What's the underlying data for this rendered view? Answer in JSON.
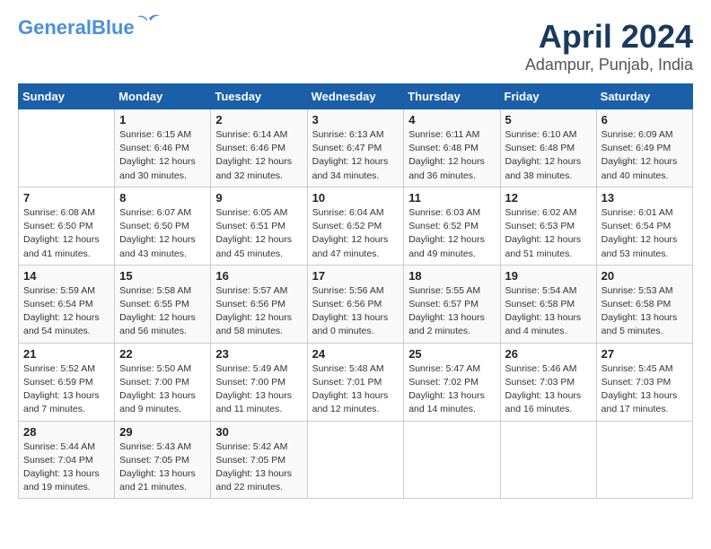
{
  "header": {
    "logo_line1": "General",
    "logo_line2": "Blue",
    "title": "April 2024",
    "subtitle": "Adampur, Punjab, India"
  },
  "days_of_week": [
    "Sunday",
    "Monday",
    "Tuesday",
    "Wednesday",
    "Thursday",
    "Friday",
    "Saturday"
  ],
  "weeks": [
    [
      {
        "day": "",
        "info": ""
      },
      {
        "day": "1",
        "info": "Sunrise: 6:15 AM\nSunset: 6:46 PM\nDaylight: 12 hours\nand 30 minutes."
      },
      {
        "day": "2",
        "info": "Sunrise: 6:14 AM\nSunset: 6:46 PM\nDaylight: 12 hours\nand 32 minutes."
      },
      {
        "day": "3",
        "info": "Sunrise: 6:13 AM\nSunset: 6:47 PM\nDaylight: 12 hours\nand 34 minutes."
      },
      {
        "day": "4",
        "info": "Sunrise: 6:11 AM\nSunset: 6:48 PM\nDaylight: 12 hours\nand 36 minutes."
      },
      {
        "day": "5",
        "info": "Sunrise: 6:10 AM\nSunset: 6:48 PM\nDaylight: 12 hours\nand 38 minutes."
      },
      {
        "day": "6",
        "info": "Sunrise: 6:09 AM\nSunset: 6:49 PM\nDaylight: 12 hours\nand 40 minutes."
      }
    ],
    [
      {
        "day": "7",
        "info": "Sunrise: 6:08 AM\nSunset: 6:50 PM\nDaylight: 12 hours\nand 41 minutes."
      },
      {
        "day": "8",
        "info": "Sunrise: 6:07 AM\nSunset: 6:50 PM\nDaylight: 12 hours\nand 43 minutes."
      },
      {
        "day": "9",
        "info": "Sunrise: 6:05 AM\nSunset: 6:51 PM\nDaylight: 12 hours\nand 45 minutes."
      },
      {
        "day": "10",
        "info": "Sunrise: 6:04 AM\nSunset: 6:52 PM\nDaylight: 12 hours\nand 47 minutes."
      },
      {
        "day": "11",
        "info": "Sunrise: 6:03 AM\nSunset: 6:52 PM\nDaylight: 12 hours\nand 49 minutes."
      },
      {
        "day": "12",
        "info": "Sunrise: 6:02 AM\nSunset: 6:53 PM\nDaylight: 12 hours\nand 51 minutes."
      },
      {
        "day": "13",
        "info": "Sunrise: 6:01 AM\nSunset: 6:54 PM\nDaylight: 12 hours\nand 53 minutes."
      }
    ],
    [
      {
        "day": "14",
        "info": "Sunrise: 5:59 AM\nSunset: 6:54 PM\nDaylight: 12 hours\nand 54 minutes."
      },
      {
        "day": "15",
        "info": "Sunrise: 5:58 AM\nSunset: 6:55 PM\nDaylight: 12 hours\nand 56 minutes."
      },
      {
        "day": "16",
        "info": "Sunrise: 5:57 AM\nSunset: 6:56 PM\nDaylight: 12 hours\nand 58 minutes."
      },
      {
        "day": "17",
        "info": "Sunrise: 5:56 AM\nSunset: 6:56 PM\nDaylight: 13 hours\nand 0 minutes."
      },
      {
        "day": "18",
        "info": "Sunrise: 5:55 AM\nSunset: 6:57 PM\nDaylight: 13 hours\nand 2 minutes."
      },
      {
        "day": "19",
        "info": "Sunrise: 5:54 AM\nSunset: 6:58 PM\nDaylight: 13 hours\nand 4 minutes."
      },
      {
        "day": "20",
        "info": "Sunrise: 5:53 AM\nSunset: 6:58 PM\nDaylight: 13 hours\nand 5 minutes."
      }
    ],
    [
      {
        "day": "21",
        "info": "Sunrise: 5:52 AM\nSunset: 6:59 PM\nDaylight: 13 hours\nand 7 minutes."
      },
      {
        "day": "22",
        "info": "Sunrise: 5:50 AM\nSunset: 7:00 PM\nDaylight: 13 hours\nand 9 minutes."
      },
      {
        "day": "23",
        "info": "Sunrise: 5:49 AM\nSunset: 7:00 PM\nDaylight: 13 hours\nand 11 minutes."
      },
      {
        "day": "24",
        "info": "Sunrise: 5:48 AM\nSunset: 7:01 PM\nDaylight: 13 hours\nand 12 minutes."
      },
      {
        "day": "25",
        "info": "Sunrise: 5:47 AM\nSunset: 7:02 PM\nDaylight: 13 hours\nand 14 minutes."
      },
      {
        "day": "26",
        "info": "Sunrise: 5:46 AM\nSunset: 7:03 PM\nDaylight: 13 hours\nand 16 minutes."
      },
      {
        "day": "27",
        "info": "Sunrise: 5:45 AM\nSunset: 7:03 PM\nDaylight: 13 hours\nand 17 minutes."
      }
    ],
    [
      {
        "day": "28",
        "info": "Sunrise: 5:44 AM\nSunset: 7:04 PM\nDaylight: 13 hours\nand 19 minutes."
      },
      {
        "day": "29",
        "info": "Sunrise: 5:43 AM\nSunset: 7:05 PM\nDaylight: 13 hours\nand 21 minutes."
      },
      {
        "day": "30",
        "info": "Sunrise: 5:42 AM\nSunset: 7:05 PM\nDaylight: 13 hours\nand 22 minutes."
      },
      {
        "day": "",
        "info": ""
      },
      {
        "day": "",
        "info": ""
      },
      {
        "day": "",
        "info": ""
      },
      {
        "day": "",
        "info": ""
      }
    ]
  ]
}
